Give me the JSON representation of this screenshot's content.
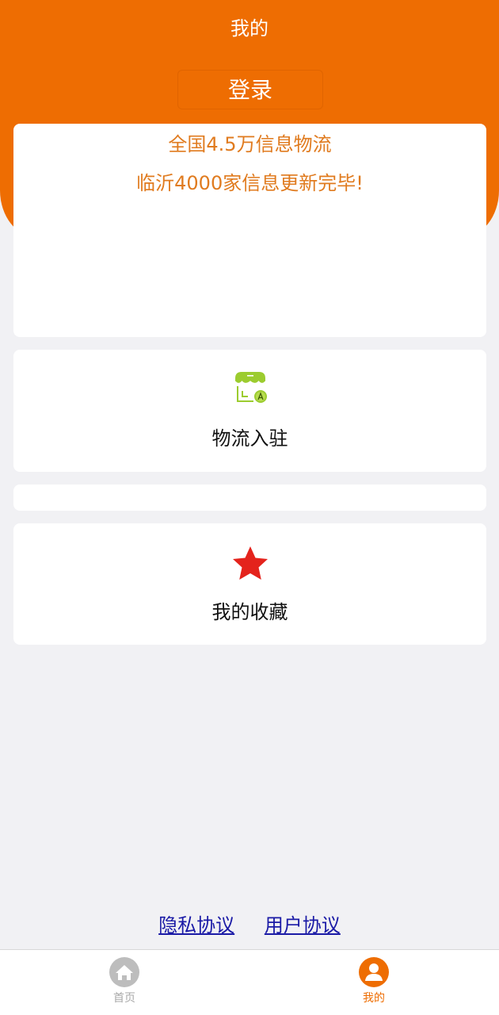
{
  "header": {
    "title": "我的",
    "login_label": "登录",
    "background_color": "#ee6d02"
  },
  "info_card": {
    "line1": "全国4.5万信息物流",
    "line2": "临沂4000家信息更新完毕!",
    "text_color": "#e07b1f"
  },
  "entry_card": {
    "icon": "storefront-icon",
    "label": "物流入驻",
    "icon_color": "#9ccc2f"
  },
  "favorite_card": {
    "icon": "star-icon",
    "label": "我的收藏",
    "icon_color": "#e4231c"
  },
  "links": {
    "privacy": "隐私协议",
    "user": "用户协议"
  },
  "tabbar": {
    "items": [
      {
        "label": "首页",
        "icon": "home-icon",
        "active": false
      },
      {
        "label": "我的",
        "icon": "user-icon",
        "active": true
      }
    ],
    "active_color": "#ee6d02",
    "inactive_color": "#a9a9a9"
  }
}
